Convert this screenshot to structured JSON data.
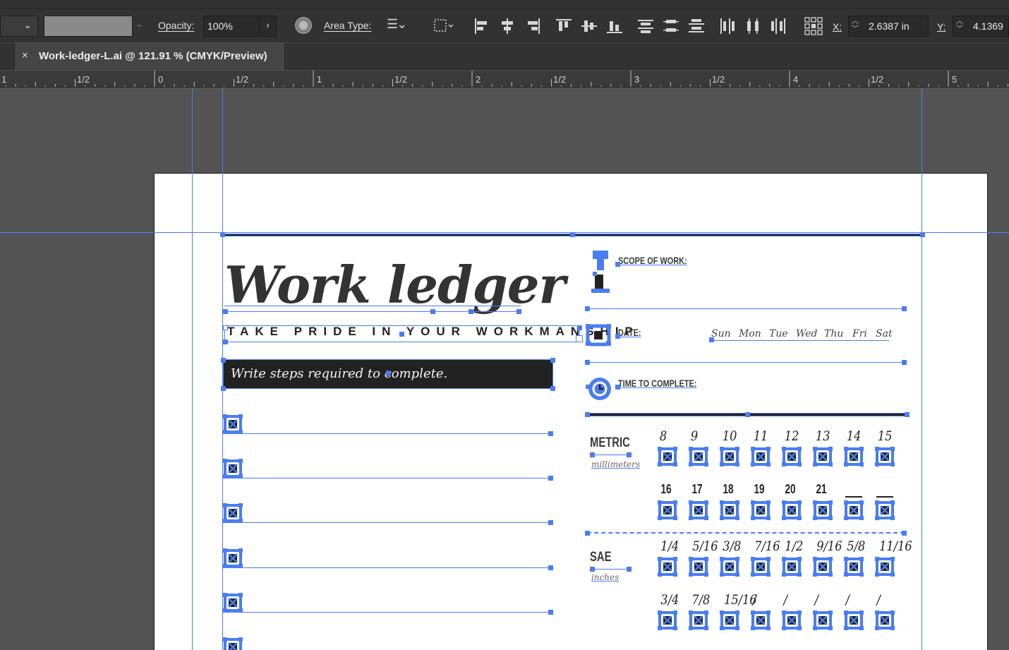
{
  "control_bar": {
    "opacity_label": "Opacity:",
    "opacity_value": "100%",
    "area_type_label": "Area Type:",
    "x_label": "X:",
    "x_value": "2.6387 in",
    "y_label": "Y:",
    "y_value": "4.1369"
  },
  "tab": {
    "close_glyph": "×",
    "title": "Work-ledger-L.ai @ 121.91 % (CMYK/Preview)"
  },
  "ruler": {
    "labels": [
      "1",
      "1/2",
      "0",
      "1/2",
      "1",
      "1/2",
      "2",
      "1/2",
      "3",
      "1/2",
      "4",
      "1/2",
      "5"
    ]
  },
  "document": {
    "title": "Work ledger",
    "tagline": "TAKE PRIDE IN YOUR WORKMANSHIP",
    "steps_banner": "Write steps required to complete.",
    "scope_label": "SCOPE OF WORK:",
    "date_label": "DATE:",
    "days": [
      "Sun",
      "Mon",
      "Tue",
      "Wed",
      "Thu",
      "Fri",
      "Sat"
    ],
    "time_label": "TIME TO COMPLETE:",
    "metric_label": "METRIC",
    "metric_unit": "millimeters",
    "metric_row1": [
      "8",
      "9",
      "10",
      "11",
      "12",
      "13",
      "14",
      "15"
    ],
    "metric_row2": [
      "16",
      "17",
      "18",
      "19",
      "20",
      "21",
      "",
      ""
    ],
    "sae_label": "SAE",
    "sae_unit": "inches",
    "sae_row1": [
      "1/4",
      "5/16",
      "3/8",
      "7/16",
      "1/2",
      "9/16",
      "5/8",
      "11/16"
    ],
    "sae_row2": [
      "3/4",
      "7/8",
      "15/16",
      "/",
      "/",
      "/",
      "/",
      "/"
    ]
  },
  "colors": {
    "selection": "#4a7df0",
    "chrome_dark": "#323232",
    "canvas": "#535353",
    "banner": "#222222"
  },
  "icons": {
    "recolor": "recolor-artwork-icon",
    "area_type": "text-align-icon",
    "placeholder": "placed-image-placeholder-icon"
  }
}
